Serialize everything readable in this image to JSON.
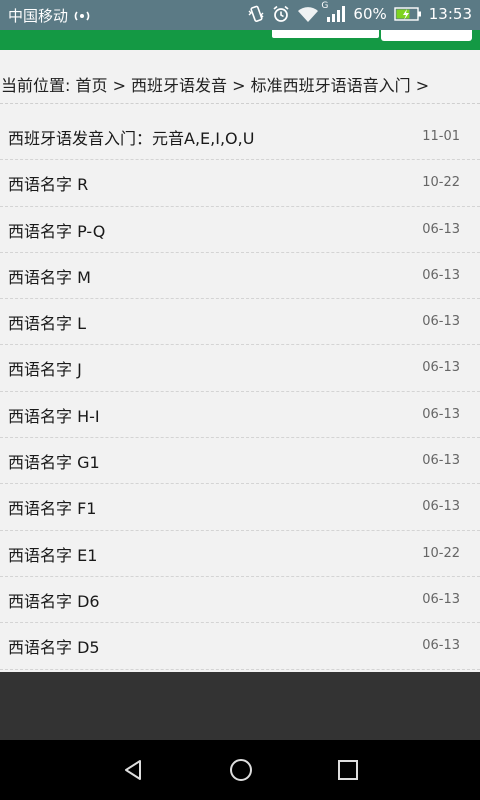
{
  "status_bar": {
    "carrier": "中国移动",
    "battery_percent": "60%",
    "time": "13:53",
    "network_letter": "G",
    "icons": [
      "nfc-icon",
      "vibrate-icon",
      "alarm-icon",
      "wifi-icon",
      "signal-icon",
      "battery-icon"
    ]
  },
  "breadcrumb": {
    "text": "当前位置: 首页 > 西班牙语发音 > 标准西班牙语语音入门 >"
  },
  "articles": [
    {
      "title": "西班牙语发音入门：元音A,E,I,O,U",
      "date": "11-01"
    },
    {
      "title": "西语名字 R",
      "date": "10-22"
    },
    {
      "title": "西语名字 P-Q",
      "date": "06-13"
    },
    {
      "title": "西语名字 M",
      "date": "06-13"
    },
    {
      "title": "西语名字 L",
      "date": "06-13"
    },
    {
      "title": "西语名字 J",
      "date": "06-13"
    },
    {
      "title": "西语名字 H-I",
      "date": "06-13"
    },
    {
      "title": "西语名字 G1",
      "date": "06-13"
    },
    {
      "title": "西语名字 F1",
      "date": "06-13"
    },
    {
      "title": "西语名字 E1",
      "date": "10-22"
    },
    {
      "title": "西语名字 D6",
      "date": "06-13"
    },
    {
      "title": "西语名字 D5",
      "date": "06-13"
    }
  ],
  "colors": {
    "header_green": "#149944",
    "status_bar": "#5b7a85",
    "battery_fill": "#7ed321"
  },
  "nav_bar": {
    "icons": [
      "back-icon",
      "home-icon",
      "recents-icon"
    ]
  }
}
